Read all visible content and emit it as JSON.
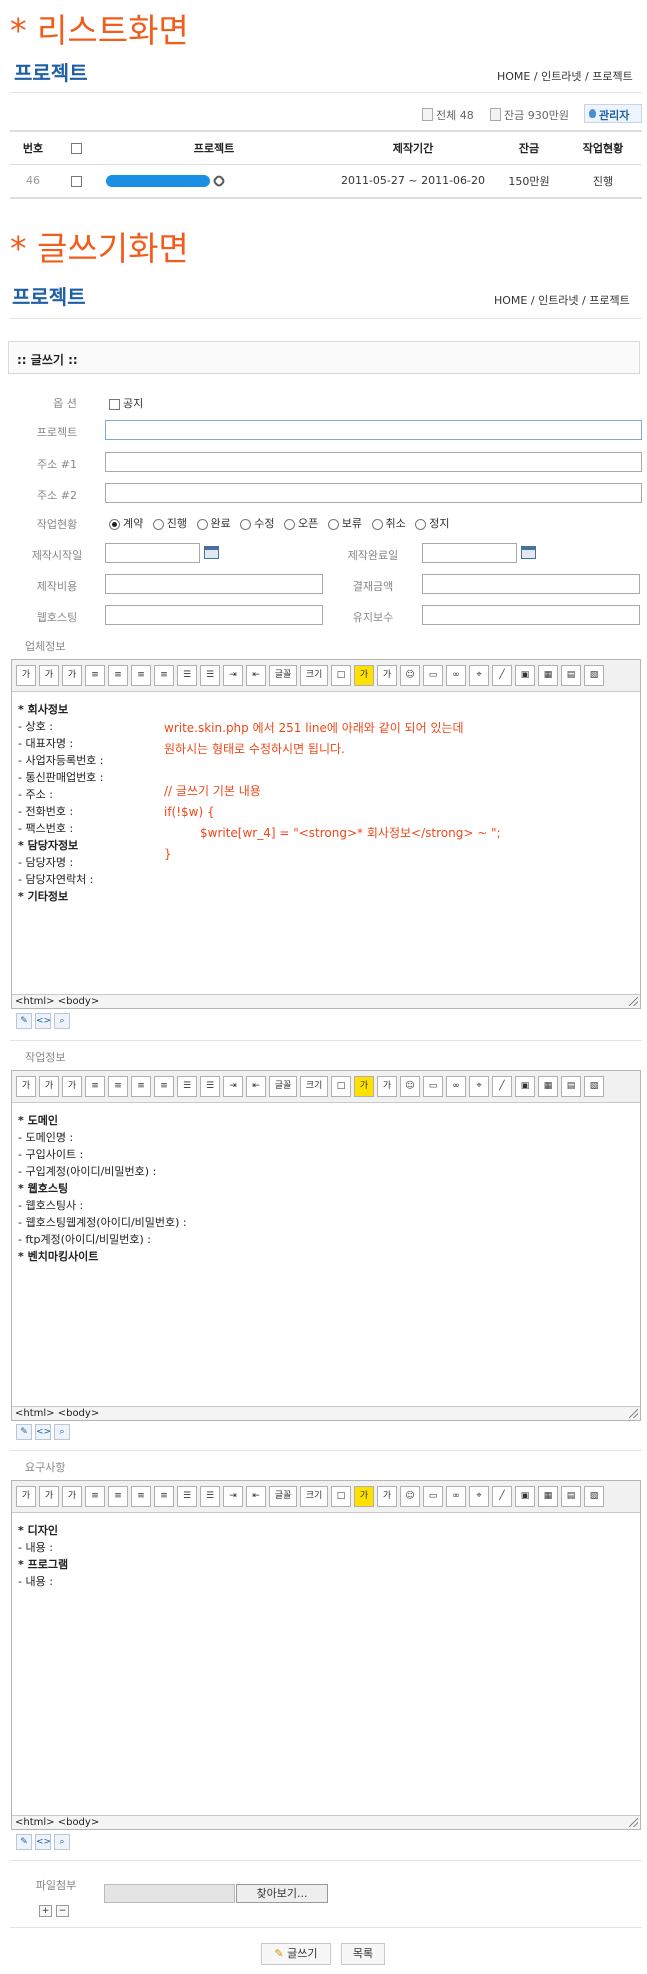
{
  "heading_list": "* 리스트화면",
  "heading_write": "* 글쓰기화면",
  "page_title": "프로젝트",
  "breadcrumb": "HOME / 인트라넷 / 프로젝트",
  "stats": {
    "total": "전체 48",
    "balance": "잔금 930만원",
    "admin": "관리자"
  },
  "table": {
    "headers": [
      "번호",
      "",
      "프로젝트",
      "제작기간",
      "잔금",
      "작업현황"
    ],
    "row": {
      "no": "46",
      "period": "2011-05-27 ~ 2011-06-20",
      "balance": "150만원",
      "status": "진행"
    }
  },
  "form": {
    "title": ":: 글쓰기 ::",
    "options_label": "옵 션",
    "notice_label": "공지",
    "project_label": "프로젝트",
    "addr1_label": "주소 #1",
    "addr2_label": "주소 #2",
    "status_label": "작업현황",
    "status_options": [
      "계약",
      "진행",
      "완료",
      "수정",
      "오픈",
      "보류",
      "취소",
      "정지"
    ],
    "start_label": "제작시작일",
    "end_label": "제작완료일",
    "cost_label": "제작비용",
    "paid_label": "결재금액",
    "hosting_label": "웹호스팅",
    "maint_label": "유지보수"
  },
  "toolbar": [
    "가",
    "가",
    "가",
    "≡",
    "≡",
    "≡",
    "≡",
    "☰",
    "☰",
    "⇥",
    "⇤",
    "글꼴",
    "크기",
    "□",
    "가",
    "가",
    "☺",
    "▭",
    "∞",
    "⌖",
    "╱",
    "▣",
    "▦",
    "▤",
    "▧"
  ],
  "editors": [
    {
      "section": "업체정보",
      "lines": [
        {
          "text": "* 회사정보",
          "bold": true
        },
        {
          "text": "- 상호 :",
          "bold": false
        },
        {
          "text": "- 대표자명 :",
          "bold": false
        },
        {
          "text": "- 사업자등록번호 :",
          "bold": false
        },
        {
          "text": "- 통신판매업번호 :",
          "bold": false
        },
        {
          "text": "- 주소 :",
          "bold": false
        },
        {
          "text": "- 전화번호 :",
          "bold": false
        },
        {
          "text": "- 팩스번호 :",
          "bold": false
        },
        {
          "text": "* 담당자정보",
          "bold": true
        },
        {
          "text": "- 담당자명 :",
          "bold": false
        },
        {
          "text": "- 담당자연락처 :",
          "bold": false
        },
        {
          "text": "* 기타정보",
          "bold": true
        }
      ],
      "footer": "<html> <body>"
    },
    {
      "section": "작업정보",
      "lines": [
        {
          "text": "* 도메인",
          "bold": true
        },
        {
          "text": "- 도메인명 :",
          "bold": false
        },
        {
          "text": "- 구입사이트 :",
          "bold": false
        },
        {
          "text": "- 구입계정(아이디/비밀번호) :",
          "bold": false
        },
        {
          "text": "* 웹호스팅",
          "bold": true
        },
        {
          "text": "- 웹호스팅사 :",
          "bold": false
        },
        {
          "text": "- 웹호스팅웹계정(아이디/비밀번호) :",
          "bold": false
        },
        {
          "text": "- ftp계정(아이디/비밀번호) :",
          "bold": false
        },
        {
          "text": "* 벤치마킹사이트",
          "bold": true
        }
      ],
      "footer": "<html> <body>"
    },
    {
      "section": "요구사항",
      "lines": [
        {
          "text": "* 디자인",
          "bold": true
        },
        {
          "text": "- 내용 :",
          "bold": false
        },
        {
          "text": "* 프로그램",
          "bold": true
        },
        {
          "text": "- 내용 :",
          "bold": false
        }
      ],
      "footer": "<html> <body>"
    }
  ],
  "note": {
    "l1": "write.skin.php 에서 251 line에 아래와 같이 되어 있는데",
    "l2": "원하시는 형태로 수정하시면 됩니다.",
    "l3": "// 글쓰기 기본 내용",
    "l4": "if(!$w) {",
    "l5": "$write[wr_4] = \"<strong>* 회사정보</strong> ~ \";",
    "l6": "}"
  },
  "file": {
    "label": "파일첨부",
    "browse": "찾아보기..."
  },
  "buttons": {
    "write": "글쓰기",
    "list": "목록"
  }
}
